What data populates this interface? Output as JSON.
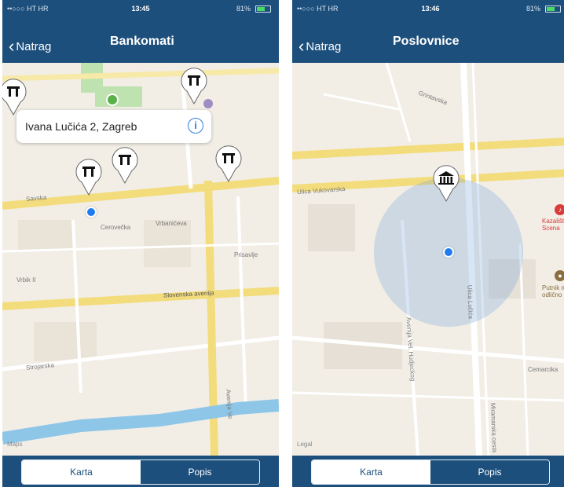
{
  "status_bar": {
    "left": {
      "carrier": "••○○○ HT HR",
      "time": "13:45",
      "battery": "81%"
    },
    "right": {
      "carrier": "••○○○ HT HR",
      "time": "13:46",
      "battery": "81%"
    }
  },
  "left_screen": {
    "back_label": "Natrag",
    "title": "Bankomati",
    "callout": "Ivana Lučića 2, Zagreb",
    "street_labels": [
      "Slovenska avenija",
      "Avenija Ve",
      "Vrbik II",
      "Cerovečka",
      "Vrbanićeva",
      "Prisavlje",
      "Strojarska",
      "Savska"
    ],
    "legal": "Maps",
    "tabs": {
      "map": "Karta",
      "list": "Popis"
    },
    "pin_icon": "atm-icon"
  },
  "right_screen": {
    "back_label": "Natrag",
    "title": "Poslovnice",
    "street_labels": [
      "Ulica Vukovarska",
      "Miramarska cesta",
      "Ulica Lučića",
      "Avenija Vel. Hudjeckog",
      "Cemarcika",
      "Grintavska"
    ],
    "poi": [
      {
        "name": "Kazalište Scena",
        "icon": "theater-icon",
        "color": "#d93a3a"
      },
      {
        "name": "Putnik mali odlično",
        "icon": "restaurant-icon",
        "color": "#8b6d3f"
      }
    ],
    "legal": "Legal",
    "tabs": {
      "map": "Karta",
      "list": "Popis"
    },
    "pin_icon": "bank-icon"
  }
}
